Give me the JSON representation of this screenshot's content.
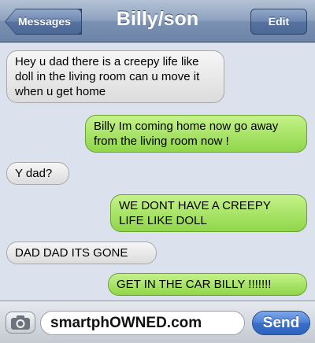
{
  "navbar": {
    "back_label": "Messages",
    "title": "Billy/son",
    "edit_label": "Edit"
  },
  "messages": [
    {
      "direction": "received",
      "text": "Hey u dad there is a creepy life like doll in the living room can u move it when u get home"
    },
    {
      "direction": "sent",
      "text": "Billy Im coming home now go away from the living room now !"
    },
    {
      "direction": "received",
      "text": "Y dad?"
    },
    {
      "direction": "sent",
      "text": "WE DONT HAVE A CREEPY LIFE LIKE DOLL"
    },
    {
      "direction": "received",
      "text": "DAD DAD ITS GONE"
    },
    {
      "direction": "sent",
      "text": "GET IN THE CAR BILLY !!!!!!!"
    }
  ],
  "composer": {
    "camera_icon": "camera-icon",
    "input_value": "smartphOWNED.com",
    "send_label": "Send"
  },
  "colors": {
    "received_bubble": "#e6e6e6",
    "sent_bubble": "#a8e36a",
    "navbar": "#8ea2bf",
    "send_button": "#3a6fc9"
  }
}
